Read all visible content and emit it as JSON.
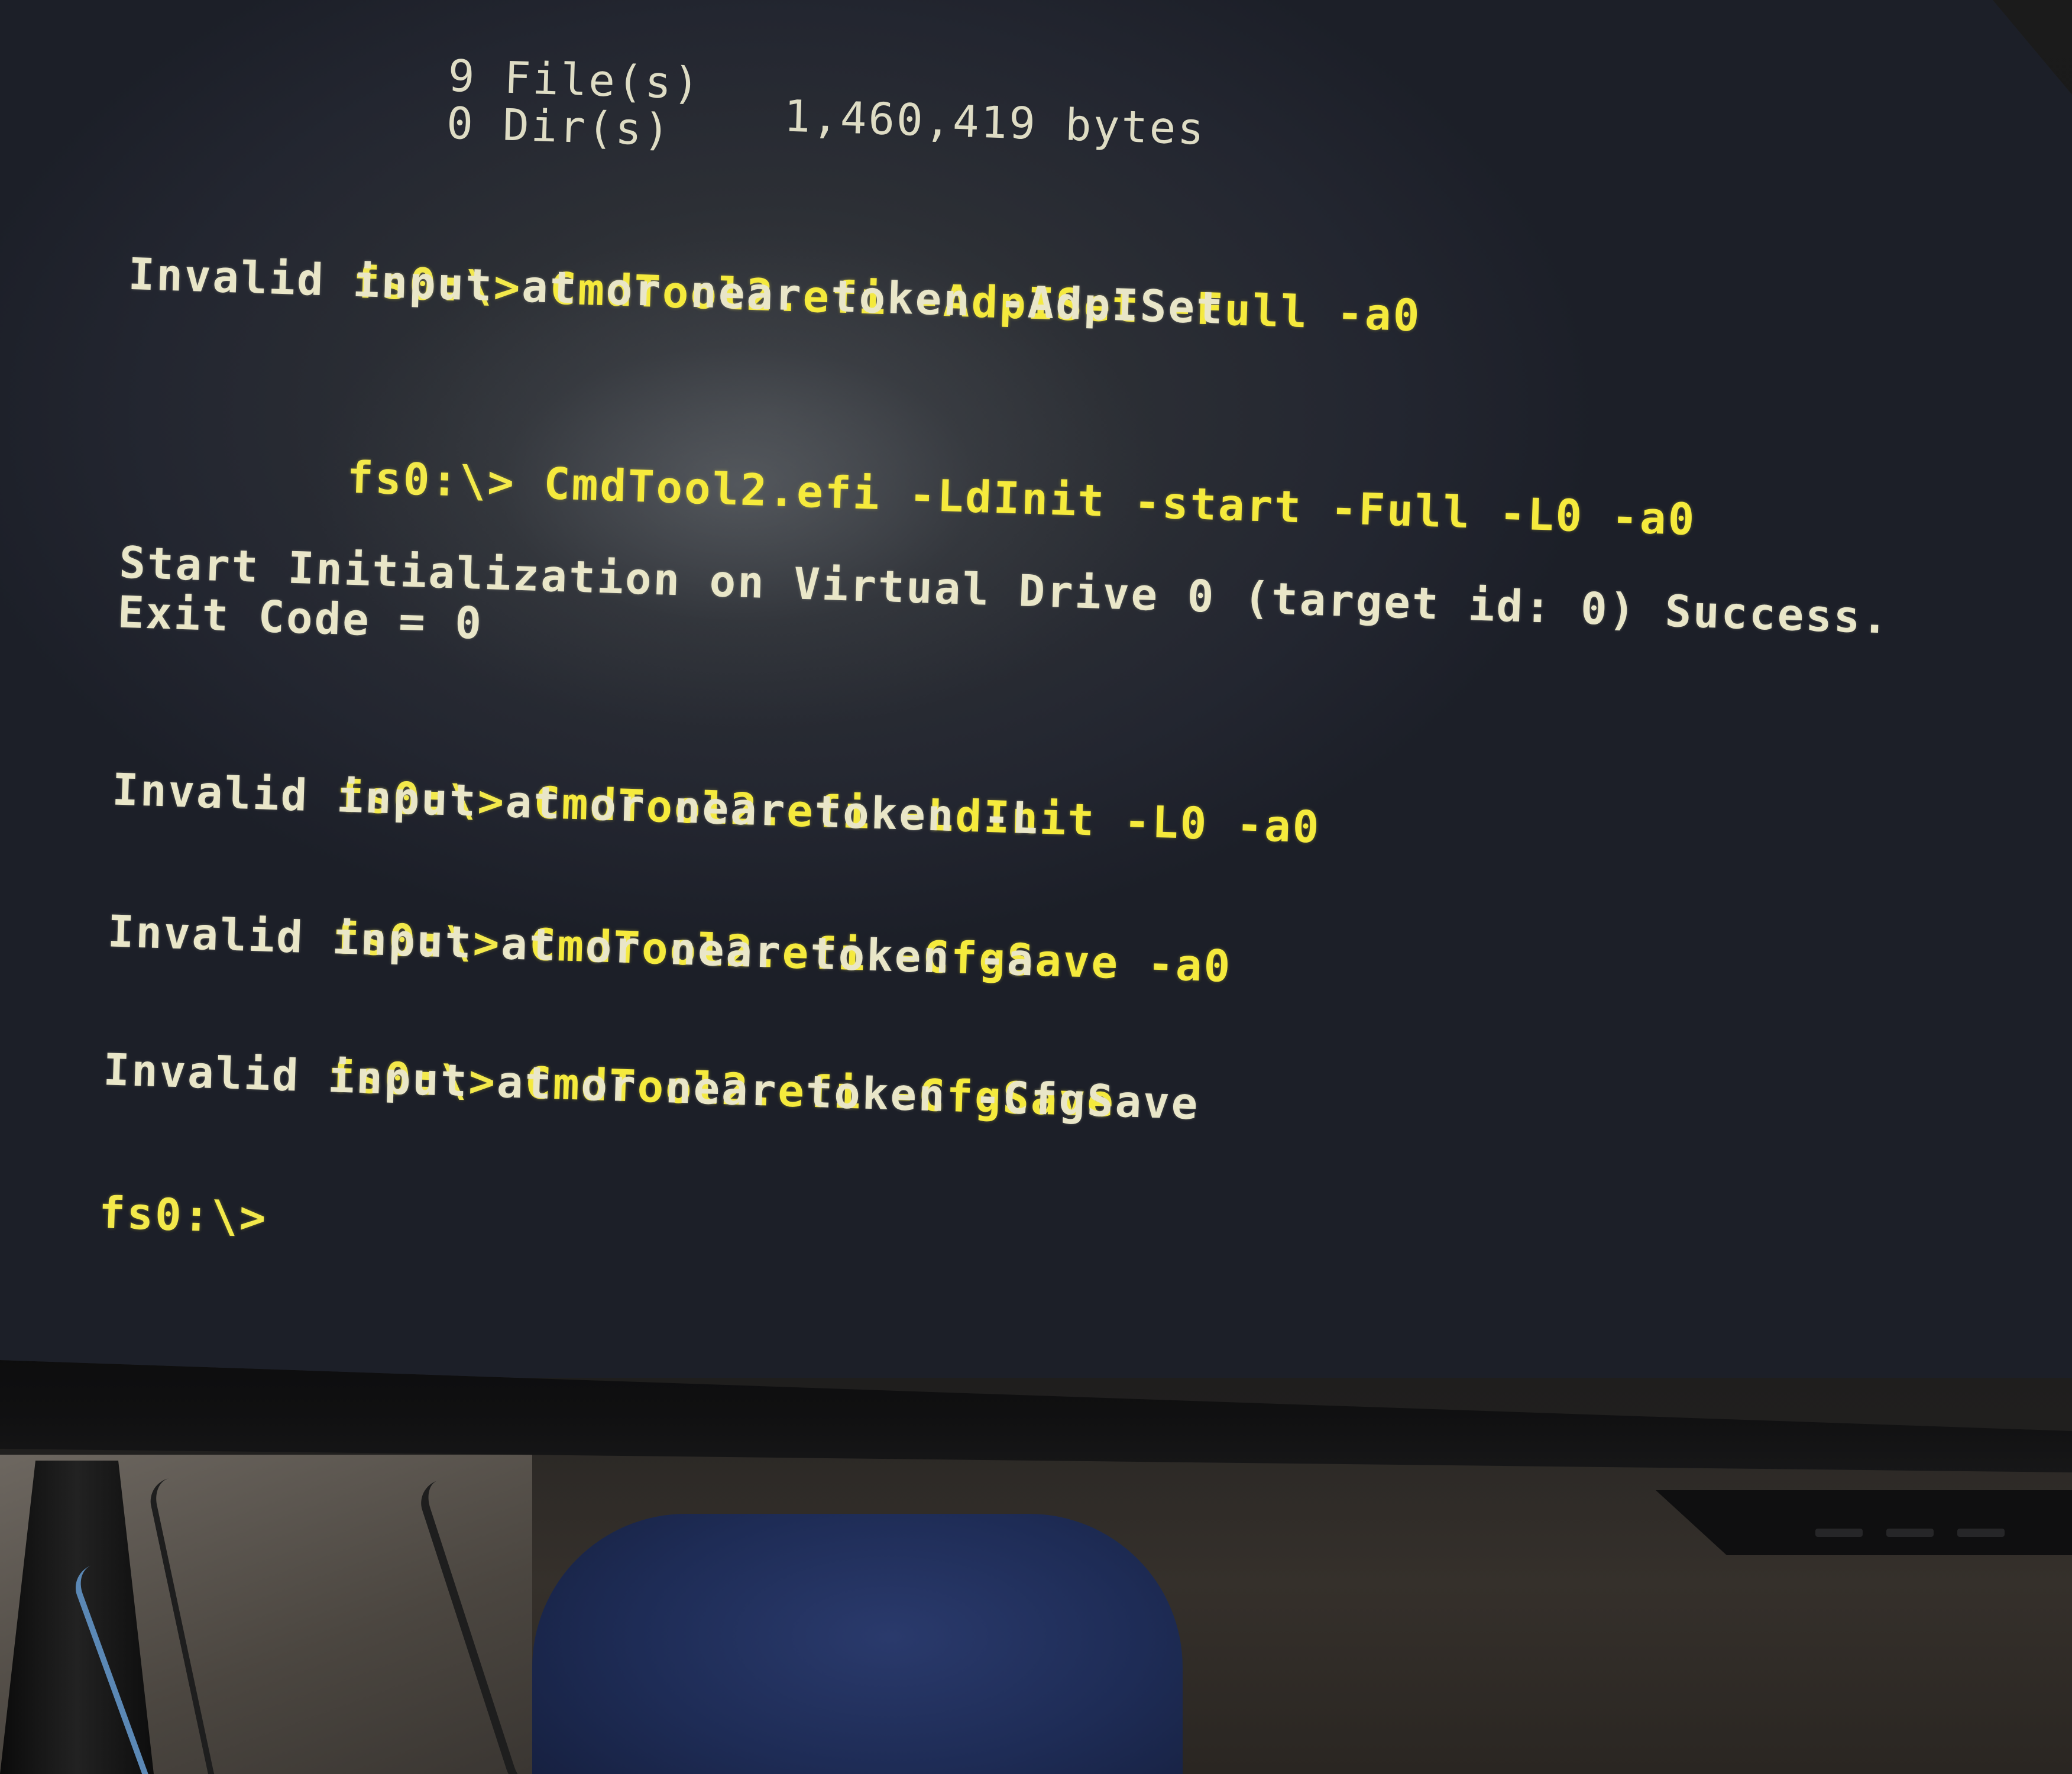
{
  "terminal": {
    "dir_summary": {
      "files_line": "9 File(s)",
      "bytes_line": "1,460,419 bytes",
      "dirs_line": "0 Dir(s)"
    },
    "entries": [
      {
        "prompt": "fs0:\\>",
        "command": "CmdTool2.efi -AdpISet -Full -a0",
        "output": [
          "Invalid input at or near token -AdpISet"
        ]
      },
      {
        "prompt": "fs0:\\>",
        "command": "CmdTool2.efi -LdInit -start -Full -L0 -a0",
        "output": [
          "Start Initialization on Virtual Drive 0 (target id: 0) Success.",
          "Exit Code = 0"
        ]
      },
      {
        "prompt": "fs0:\\>",
        "command": "CmdTool2.efi -LdInit -L0 -a0",
        "output": [
          "Invalid input at or near token -L"
        ]
      },
      {
        "prompt": "fs0:\\>",
        "command": "CmdTool2.efi -CfgSave -a0",
        "output": [
          "Invalid input at or near token -a"
        ]
      },
      {
        "prompt": "fs0:\\>",
        "command": "CmdTool2.efi -CfgSave",
        "output": [
          "Invalid input at or near token -CfgSave"
        ]
      }
    ],
    "final_prompt": "fs0:\\>"
  },
  "colors": {
    "prompt_yellow": "#f3e94a",
    "output_white": "#e9e6c8",
    "screen_background": "#2c2f35"
  }
}
